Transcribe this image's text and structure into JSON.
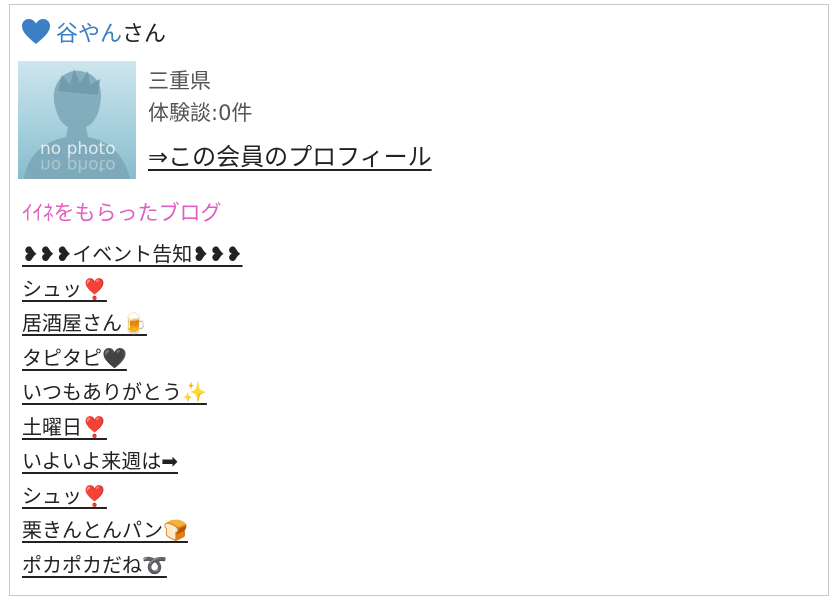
{
  "header": {
    "name": "谷やん",
    "suffix": "さん",
    "heart_color": "#3b7fc4"
  },
  "profile": {
    "photo_label": "no photo",
    "prefecture": "三重県",
    "experience": "体験談:0件",
    "profile_link": "⇒この会員のプロフィール"
  },
  "blog_section": {
    "title": "ｲｲﾈをもらったブログ",
    "title_color": "#e05fbf",
    "items": [
      {
        "label": "❥❥❥イベント告知❥❥❥"
      },
      {
        "label": "シュッ❣️"
      },
      {
        "label": "居酒屋さん🍺"
      },
      {
        "label": "タピタピ🖤"
      },
      {
        "label": "いつもありがとう✨"
      },
      {
        "label": "土曜日❣️"
      },
      {
        "label": "いよいよ来週は➡"
      },
      {
        "label": "シュッ❣️"
      },
      {
        "label": "栗きんとんパン🍞"
      },
      {
        "label": "ポカポカだね➰"
      }
    ]
  }
}
